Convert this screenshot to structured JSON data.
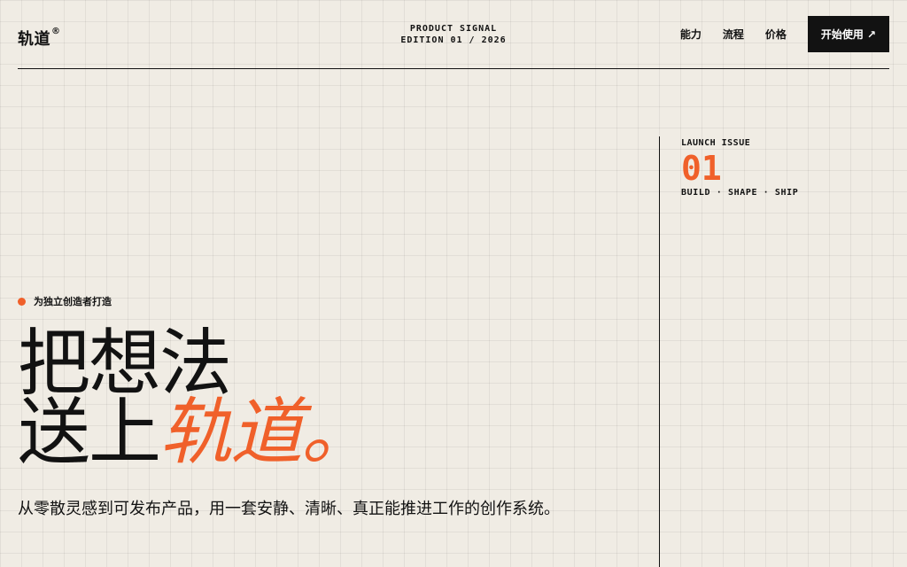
{
  "header": {
    "logo": "轨道",
    "logo_mark": "®",
    "edition_line1": "PRODUCT SIGNAL",
    "edition_line2": "EDITION 01 / 2026"
  },
  "nav": {
    "items": [
      {
        "label": "能力"
      },
      {
        "label": "流程"
      },
      {
        "label": "价格"
      }
    ],
    "cta_label": "开始使用",
    "cta_icon": "↗"
  },
  "issue": {
    "label": "LAUNCH ISSUE",
    "number": "01",
    "tags": "BUILD · SHAPE · SHIP"
  },
  "hero": {
    "tagline": "为独立创造者打造",
    "headline_line1": "把想法",
    "headline_line2_plain": "送上",
    "headline_line2_accent": "轨道。",
    "description": "从零散灵感到可发布产品，用一套安静、清晰、真正能推进工作的创作系统。"
  },
  "colors": {
    "background": "#f0ece4",
    "ink": "#121212",
    "accent": "#f0602a"
  }
}
